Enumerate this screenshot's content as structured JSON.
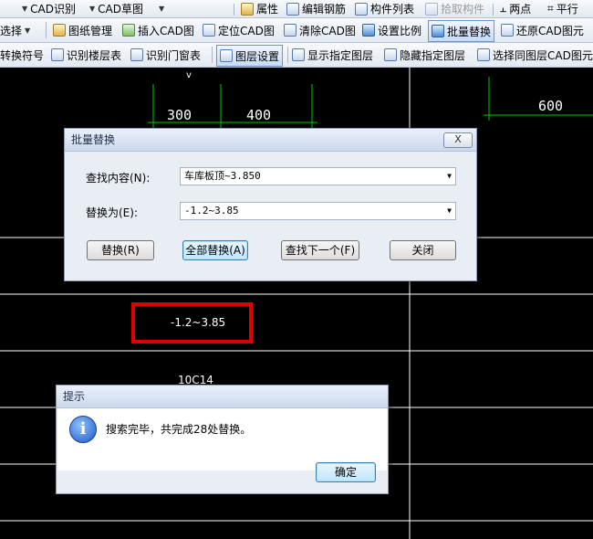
{
  "toolbar1": {
    "items": [
      "CAD识别",
      "CAD草图",
      "属性",
      "编辑钢筋",
      "构件列表",
      "拾取构件",
      "两点",
      "平行"
    ]
  },
  "toolbar2": {
    "items": [
      "图纸管理",
      "插入CAD图",
      "定位CAD图",
      "清除CAD图",
      "设置比例",
      "批量替换",
      "还原CAD图元"
    ]
  },
  "toolbar3": {
    "items": [
      "转换符号",
      "识别楼层表",
      "识别门窗表",
      "图层设置",
      "显示指定图层",
      "隐藏指定图层",
      "选择同图层CAD图元"
    ]
  },
  "canvas": {
    "dim_left": "300",
    "dim_mid": "400",
    "dim_right": "600",
    "result_text": "-1.2~3.85",
    "label_10c14": "10C14"
  },
  "replace_dialog": {
    "title": "批量替换",
    "close_label": "X",
    "find_label": "查找内容(N):",
    "find_value": "车库板顶~3.850",
    "replace_label": "替换为(E):",
    "replace_value": "-1.2~3.85",
    "btn_replace": "替换(R)",
    "btn_replace_all": "全部替换(A)",
    "btn_find_next": "查找下一个(F)",
    "btn_close": "关闭"
  },
  "message_box": {
    "title": "提示",
    "icon_glyph": "i",
    "message": "搜索完毕，共完成28处替换。",
    "ok_label": "确定"
  },
  "colors": {
    "canvas_bg": "#000000",
    "grid_line": "#ffffff",
    "dim_line": "#00c800",
    "highlight": "#e00000"
  }
}
